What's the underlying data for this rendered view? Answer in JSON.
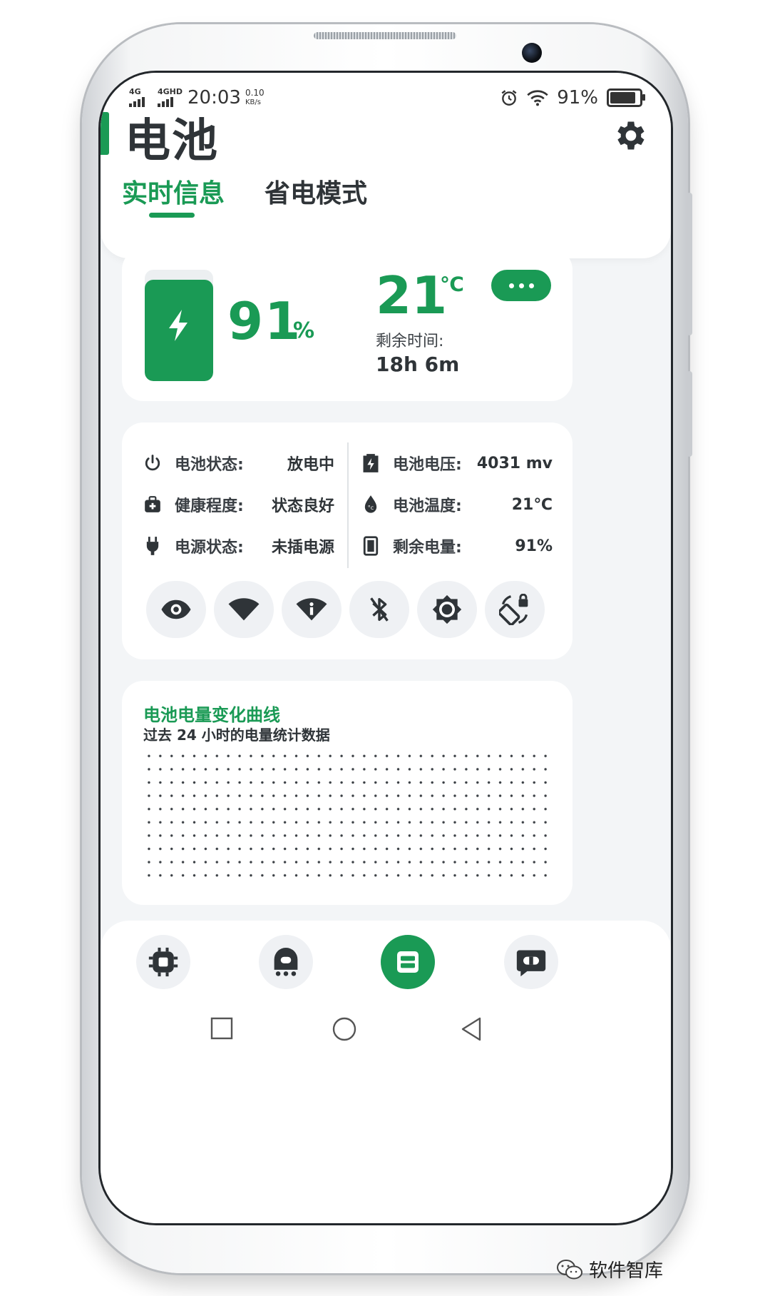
{
  "status_bar": {
    "signal1_label": "4G",
    "signal2_label": "4GHD",
    "time": "20:03",
    "net_speed_value": "0.10",
    "net_speed_unit": "KB/s",
    "battery_text": "91%",
    "battery_level": 0.91,
    "icons": [
      "alarm-icon",
      "wifi-icon",
      "battery-icon"
    ]
  },
  "header": {
    "title": "电池",
    "settings_icon": "gear-icon",
    "tabs": [
      {
        "label": "实时信息",
        "active": true
      },
      {
        "label": "省电模式",
        "active": false
      }
    ]
  },
  "overview": {
    "battery_level": 0.91,
    "percent": "91",
    "percent_unit": "%",
    "temperature": "21",
    "temperature_unit": "℃",
    "remaining_label": "剩余时间:",
    "remaining_value": "18h 6m",
    "more_icon": "more-dots-icon"
  },
  "details": {
    "left": [
      {
        "icon": "power-icon",
        "label": "电池状态:",
        "value": "放电中"
      },
      {
        "icon": "first-aid-icon",
        "label": "健康程度:",
        "value": "状态良好"
      },
      {
        "icon": "plug-icon",
        "label": "电源状态:",
        "value": "未插电源"
      }
    ],
    "right": [
      {
        "icon": "voltage-icon",
        "label": "电池电压:",
        "value": "4031 mv"
      },
      {
        "icon": "temperature-drop-icon",
        "label": "电池温度:",
        "value": "21℃"
      },
      {
        "icon": "battery-level-icon",
        "label": "剩余电量:",
        "value": "91%"
      }
    ],
    "quick_toggles": [
      "eye-icon",
      "wifi-icon",
      "wifi-info-icon",
      "bluetooth-off-icon",
      "brightness-icon",
      "rotation-lock-icon"
    ]
  },
  "chart": {
    "title": "电池电量变化曲线",
    "subtitle": "过去 24 小时的电量统计数据"
  },
  "chart_data": {
    "type": "line",
    "title": "电池电量变化曲线",
    "subtitle": "过去 24 小时的电量统计数据",
    "series": [],
    "grid": true
  },
  "bottom_nav": {
    "items": [
      {
        "icon": "chip-icon",
        "active": false
      },
      {
        "icon": "ghost-icon",
        "active": false
      },
      {
        "icon": "battery-card-icon",
        "active": true
      },
      {
        "icon": "message-icon",
        "active": false
      }
    ]
  },
  "system_nav": [
    "recent-apps-icon",
    "home-icon",
    "back-icon"
  ],
  "watermark": {
    "text": "软件智库",
    "icon": "wechat-icon"
  },
  "colors": {
    "accent": "#1a9a55",
    "background": "#f3f5f7",
    "card": "#ffffff",
    "text": "#2f3438"
  }
}
